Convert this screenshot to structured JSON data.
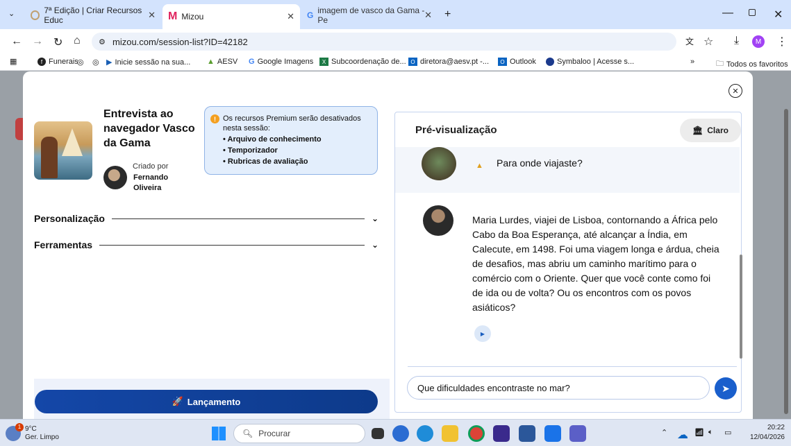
{
  "browser": {
    "tabs": [
      {
        "title": "7ª Edição | Criar Recursos Educ"
      },
      {
        "title": "Mizou"
      },
      {
        "title": "imagem de vasco da Gama - Pe"
      }
    ],
    "url": "mizou.com/session-list?ID=42182",
    "profile_initial": "M",
    "bookmarks": [
      {
        "label": "Funerais"
      },
      {
        "label": ""
      },
      {
        "label": "Inicie sessão na sua..."
      },
      {
        "label": "AESV"
      },
      {
        "label": "Google Imagens"
      },
      {
        "label": "Subcoordenação de..."
      },
      {
        "label": "diretora@aesv.pt -..."
      },
      {
        "label": "Outlook"
      },
      {
        "label": "Symbaloo | Acesse s..."
      }
    ],
    "all_bookmarks": "Todos os favoritos"
  },
  "session": {
    "title": "Entrevista ao navegador Vasco da Gama",
    "created_by_label": "Criado por",
    "author": "Fernando Oliveira",
    "premium_notice": "Os recursos Premium serão desativados nesta sessão:",
    "premium_items": [
      "Arquivo de conhecimento",
      "Temporizador",
      "Rubricas de avaliação"
    ],
    "sections": [
      "Personalização",
      "Ferramentas"
    ],
    "launch_label": "Lançamento"
  },
  "preview": {
    "title": "Pré-visualização",
    "theme_label": "Claro",
    "user_message": "Para onde viajaste?",
    "bot_message": "Maria Lurdes, viajei de Lisboa, contornando a África pelo Cabo da Boa Esperança, até alcançar a Índia, em Calecute, em 1498. Foi uma viagem longa e árdua, cheia de desafios, mas abriu um caminho marítimo para o comércio com o Oriente. Quer que você conte como foi de ida ou de volta? Ou os encontros com os povos asiáticos?",
    "input_value": "Que dificuldades encontraste no mar?"
  },
  "taskbar": {
    "weather_temp": "9°C",
    "weather_desc": "Ger. Limpo",
    "weather_badge": "1",
    "search_placeholder": "Procurar",
    "time": "20:22",
    "date": "12/04/2026"
  }
}
